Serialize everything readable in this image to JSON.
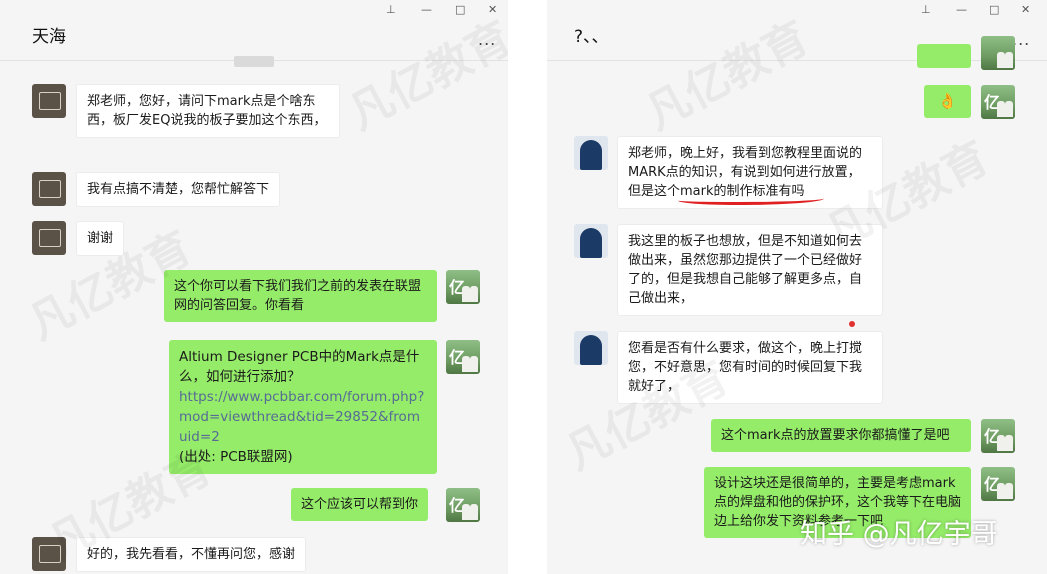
{
  "left": {
    "title": "天海",
    "controls": [
      "⊥",
      "—",
      "□",
      "✕"
    ],
    "more": "...",
    "messages": [
      "郑老师，您好，请问下mark点是个啥东西，板厂发EQ说我的板子要加这个东西，",
      "我有点搞不清楚，您帮忙解答下",
      "谢谢",
      "这个你可以看下我们我们之前的发表在联盟网的问答回复。你看看",
      "Altium Designer PCB中的Mark点是什么，如何进行添加？",
      "https://www.pcbbar.com/forum.php?mod=viewthread&tid=29852&fromuid=2",
      "(出处: PCB联盟网)",
      "这个应该可以帮到你",
      "好的，我先看看，不懂再问您，感谢"
    ]
  },
  "right": {
    "title": "?、、",
    "controls": [
      "⊥",
      "—",
      "□",
      "✕"
    ],
    "more": "...",
    "messages": [
      "👌",
      "郑老师，晚上好，我看到您教程里面说的MARK点的知识，有说到如何进行放置，但是这个mark的制作标准有吗",
      "我这里的板子也想放，但是不知道如何去做出来，虽然您那边提供了一个已经做好了的，但是我想自己能够了解更多点，自己做出来，",
      "您看是否有什么要求，做这个，晚上打搅您，不好意思，您有时间的时候回复下我就好了，",
      "这个mark点的放置要求你都搞懂了是吧",
      "设计这块还是很简单的，主要是考虑mark点的焊盘和他的保护环，这个我等下在电脑边上给你发下资料参考一下吧"
    ]
  },
  "avatar_mark": "亿",
  "watermark": "凡亿教育",
  "footer_watermark": "知乎 @凡亿宇哥"
}
